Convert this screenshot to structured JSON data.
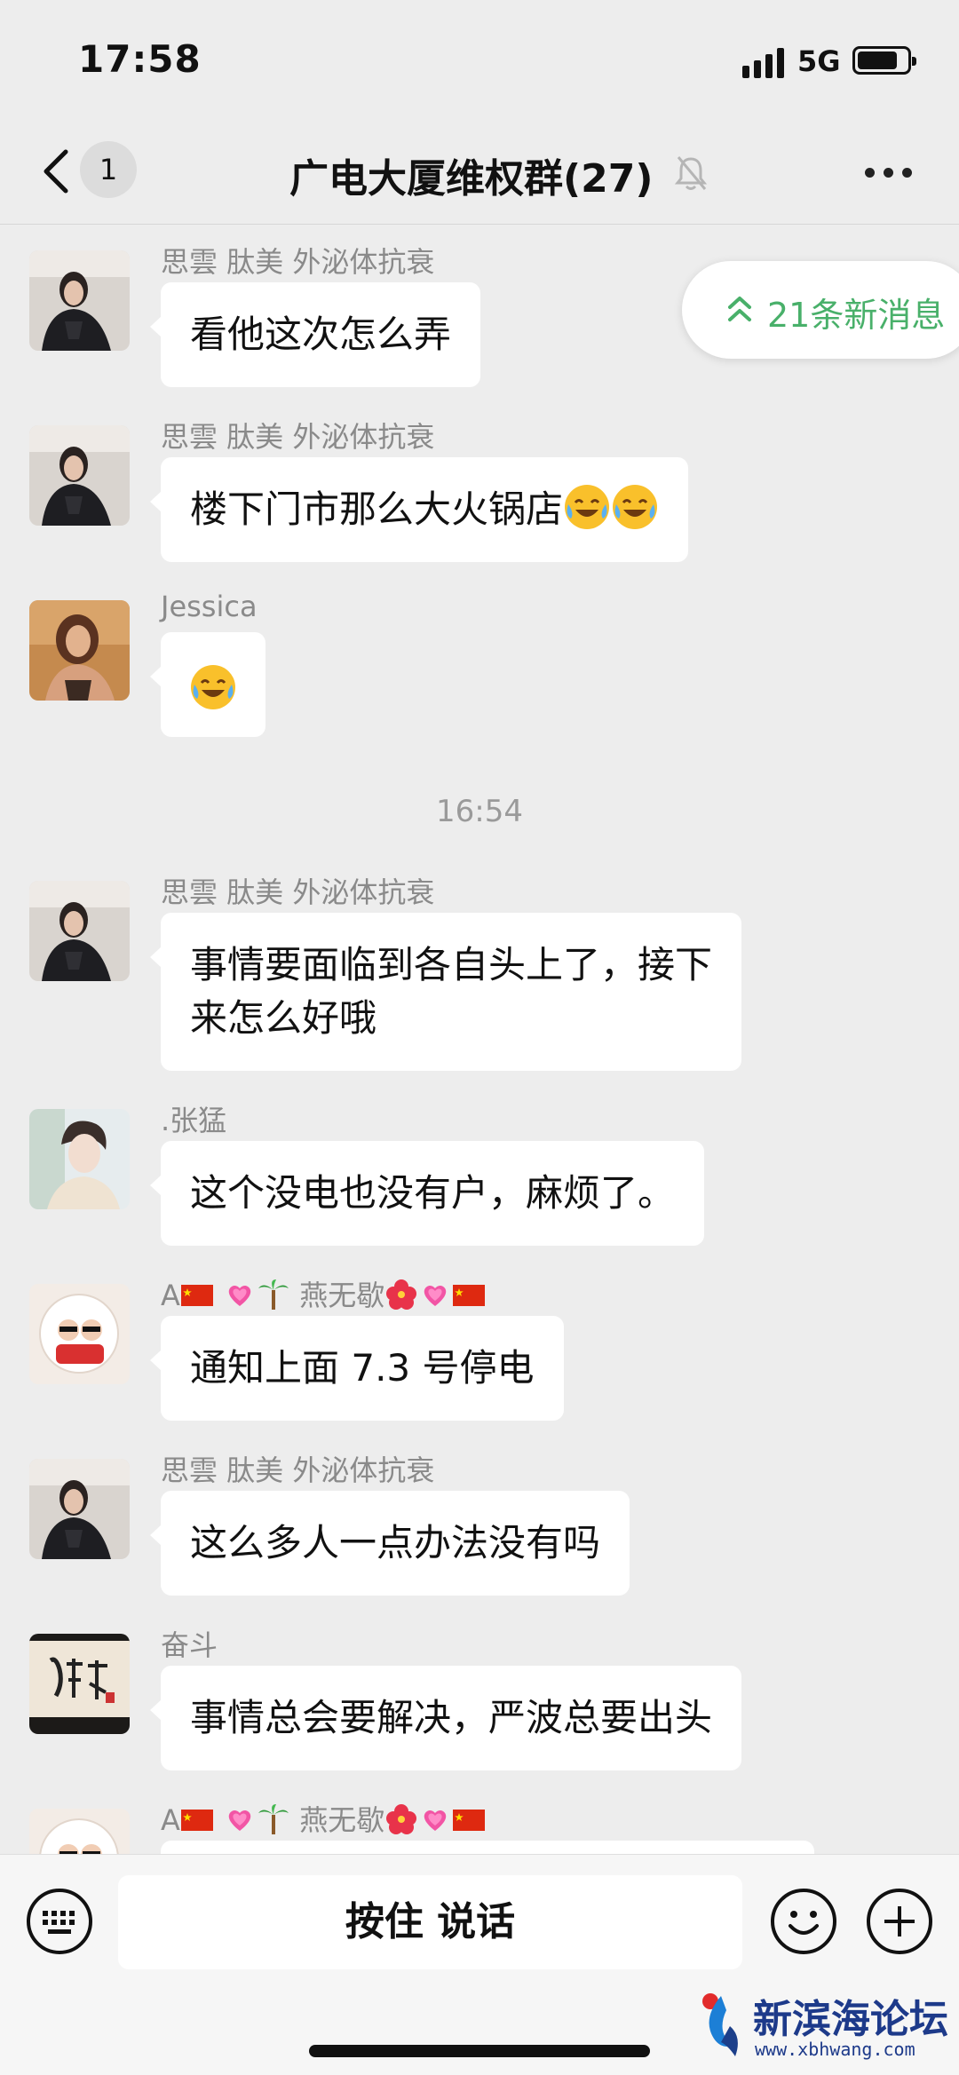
{
  "status_bar": {
    "time": "17:58",
    "network": "5G"
  },
  "nav": {
    "back_badge": "1",
    "title": "广电大厦维权群(27)"
  },
  "new_messages_pill": {
    "label": "21条新消息",
    "color": "#49b06a"
  },
  "messages": [
    {
      "sender": "思雲  肽美 外泌体抗衰",
      "text": "看他这次怎么弄"
    },
    {
      "sender": "思雲  肽美 外泌体抗衰",
      "text": "楼下门市那么大火锅店"
    },
    {
      "sender": "Jessica",
      "text": ""
    },
    {
      "divider": "16:54"
    },
    {
      "sender": "思雲  肽美 外泌体抗衰",
      "text_line1": "事情要面临到各自头上了，接下",
      "text_line2": "来怎么好哦"
    },
    {
      "sender": ".张猛",
      "text": "这个没电也没有户，麻烦了。"
    },
    {
      "sender_a": "A",
      "sender_b": "燕无歇",
      "text": "通知上面 7.3 号停电"
    },
    {
      "sender": "思雲  肽美 外泌体抗衰",
      "text": "这么多人一点办法没有吗"
    },
    {
      "sender": "奋斗",
      "text": "事情总会要解决，严波总要出头"
    },
    {
      "sender_a": "A",
      "sender_b": "燕无歇"
    }
  ],
  "input_bar": {
    "voice_label": "按住 说话"
  },
  "watermark": {
    "title": "新滨海论坛",
    "url": "www.xbhwang.com"
  },
  "colors": {
    "background": "#ededed",
    "bubble": "#ffffff",
    "accent_green": "#49b06a"
  }
}
